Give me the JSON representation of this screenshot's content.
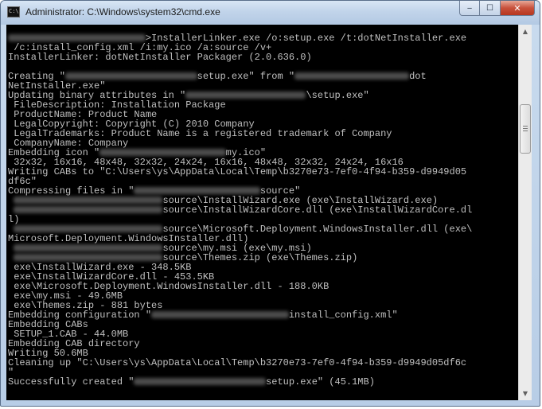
{
  "window": {
    "title": "Administrator: C:\\Windows\\system32\\cmd.exe",
    "icon": "cmd-icon",
    "caption": {
      "minimize_icon": "minimize-icon",
      "maximize_icon": "maximize-icon",
      "close_icon": "close-icon",
      "minimize_glyph": "‒",
      "maximize_glyph": "☐",
      "close_glyph": "✕"
    }
  },
  "scrollbar": {
    "up_glyph": "▲",
    "down_glyph": "▼",
    "position_fraction": 0.22
  },
  "console": {
    "lines": [
      [
        {
          "blur": true,
          "text": "C:\\x\\xxx xxxxxxxxxx\\xxxx"
        },
        {
          "text": ">InstallerLinker.exe /o:setup.exe /t:dotNetInstaller.exe"
        }
      ],
      [
        {
          "text": " /c:install_config.xml /i:my.ico /a:source /v+"
        }
      ],
      [
        {
          "text": "InstallerLinker: dotNetInstaller Packager (2.0.636.0)"
        }
      ],
      [
        {
          "text": ""
        }
      ],
      [
        {
          "text": "Creating \""
        },
        {
          "blur": true,
          "text": "x\\xxx xxxxxxxxxxxxxxxx\\"
        },
        {
          "text": "setup.exe\" from \""
        },
        {
          "blur": true,
          "text": "xxxxxxxxxxxxxxxxxxxx"
        },
        {
          "text": "dot"
        }
      ],
      [
        {
          "text": "NetInstaller.exe\""
        }
      ],
      [
        {
          "text": "Updating binary attributes in \""
        },
        {
          "blur": true,
          "text": "xxxxxxxxxxxxxxxxxxxxx"
        },
        {
          "text": "\\setup.exe\""
        }
      ],
      [
        {
          "text": " FileDescription: Installation Package"
        }
      ],
      [
        {
          "text": " ProductName: Product Name"
        }
      ],
      [
        {
          "text": " LegalCopyright: Copyright (C) 2010 Company"
        }
      ],
      [
        {
          "text": " LegalTrademarks: Product Name is a registered trademark of Company"
        }
      ],
      [
        {
          "text": " CompanyName: Company"
        }
      ],
      [
        {
          "text": "Embedding icon \""
        },
        {
          "blur": true,
          "text": "xxxxxxxxxxxxxxxxxxxxxx"
        },
        {
          "text": "my.ico\""
        }
      ],
      [
        {
          "text": " 32x32, 16x16, 48x48, 32x32, 24x24, 16x16, 48x48, 32x32, 24x24, 16x16"
        }
      ],
      [
        {
          "text": "Writing CABs to \"C:\\Users\\ys\\AppData\\Local\\Temp\\b3270e73-7ef0-4f94-b359-d9949d05"
        }
      ],
      [
        {
          "text": "df6c\""
        }
      ],
      [
        {
          "text": "Compressing files in \""
        },
        {
          "blur": true,
          "text": "xxxxxxxxxxxxxxxxxxxxxx"
        },
        {
          "text": "source\""
        }
      ],
      [
        {
          "text": " "
        },
        {
          "blur": true,
          "text": "xxxxxxxxxxxxxxxxxxxxxxxxxx"
        },
        {
          "text": "source\\InstallWizard.exe (exe\\InstallWizard.exe)"
        }
      ],
      [
        {
          "text": " "
        },
        {
          "blur": true,
          "text": "xxxxxxxxxxxxxxxxxxxxxxxxxx"
        },
        {
          "text": "source\\InstallWizardCore.dll (exe\\InstallWizardCore.dl"
        }
      ],
      [
        {
          "text": "l)"
        }
      ],
      [
        {
          "text": " "
        },
        {
          "blur": true,
          "text": "xxxxxxxxxxxxxxxxxxxxxxxxxx"
        },
        {
          "text": "source\\Microsoft.Deployment.WindowsInstaller.dll (exe\\"
        }
      ],
      [
        {
          "text": "Microsoft.Deployment.WindowsInstaller.dll)"
        }
      ],
      [
        {
          "text": " "
        },
        {
          "blur": true,
          "text": "xxxxxxxxxxxxxxxxxxxxxxxxxx"
        },
        {
          "text": "source\\my.msi (exe\\my.msi)"
        }
      ],
      [
        {
          "text": " "
        },
        {
          "blur": true,
          "text": "xxxxxxxxxxxxxxxxxxxxxxxxxx"
        },
        {
          "text": "source\\Themes.zip (exe\\Themes.zip)"
        }
      ],
      [
        {
          "text": " exe\\InstallWizard.exe - 348.5KB"
        }
      ],
      [
        {
          "text": " exe\\InstallWizardCore.dll - 453.5KB"
        }
      ],
      [
        {
          "text": " exe\\Microsoft.Deployment.WindowsInstaller.dll - 188.0KB"
        }
      ],
      [
        {
          "text": " exe\\my.msi - 49.6MB"
        }
      ],
      [
        {
          "text": " exe\\Themes.zip - 881 bytes"
        }
      ],
      [
        {
          "text": "Embedding configuration \""
        },
        {
          "blur": true,
          "text": "xxxxxxxxxxxxxxxxxxxxxxxx"
        },
        {
          "text": "install_config.xml\""
        }
      ],
      [
        {
          "text": "Embedding CABs"
        }
      ],
      [
        {
          "text": " SETUP_1.CAB - 44.0MB"
        }
      ],
      [
        {
          "text": "Embedding CAB directory"
        }
      ],
      [
        {
          "text": "Writing 50.6MB"
        }
      ],
      [
        {
          "text": "Cleaning up \"C:\\Users\\ys\\AppData\\Local\\Temp\\b3270e73-7ef0-4f94-b359-d9949d05df6c"
        }
      ],
      [
        {
          "text": "\""
        }
      ],
      [
        {
          "text": "Successfully created \""
        },
        {
          "blur": true,
          "text": "xxxxxxxxxxxxxxxxxxxxxxx"
        },
        {
          "text": "setup.exe\" (45.1MB)"
        }
      ]
    ]
  }
}
